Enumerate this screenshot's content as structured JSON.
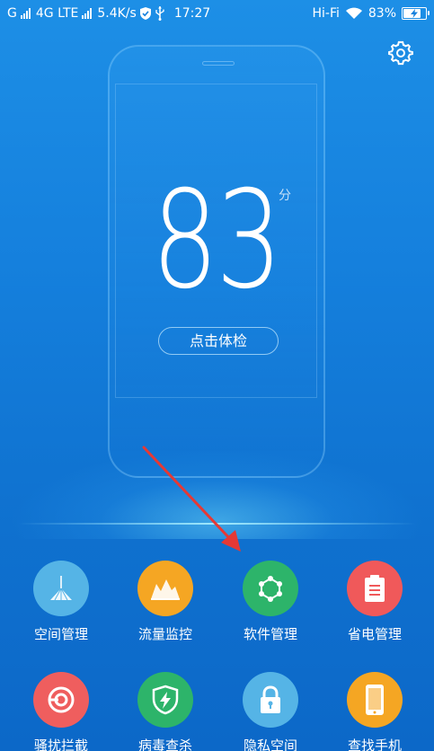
{
  "status_bar": {
    "carrier": "G",
    "network": "4G LTE",
    "speed": "5.4K/s",
    "time": "17:27",
    "wifi_label": "Hi-Fi",
    "battery_percent": "83%",
    "battery_level": 0.83
  },
  "score": {
    "value": "83",
    "unit": "分"
  },
  "check_button": {
    "label": "点击体检"
  },
  "grid": {
    "items": [
      {
        "label": "空间管理",
        "icon": "broom-icon",
        "color": "#4fb0e2"
      },
      {
        "label": "流量监控",
        "icon": "traffic-chart-icon",
        "color": "#f5a623"
      },
      {
        "label": "软件管理",
        "icon": "app-network-icon",
        "color": "#2db46a"
      },
      {
        "label": "省电管理",
        "icon": "battery-clipboard-icon",
        "color": "#f0595a"
      },
      {
        "label": "骚扰拦截",
        "icon": "target-block-icon",
        "color": "#ef5e5e"
      },
      {
        "label": "病毒查杀",
        "icon": "shield-bolt-icon",
        "color": "#2db46a"
      },
      {
        "label": "隐私空间",
        "icon": "lock-icon",
        "color": "#4fb0e2"
      },
      {
        "label": "查找手机",
        "icon": "phone-find-icon",
        "color": "#f5a623"
      }
    ]
  },
  "colors": {
    "background_top": "#1d8fe6",
    "background_bottom": "#0c68c8",
    "annotation_arrow": "#e53935"
  }
}
